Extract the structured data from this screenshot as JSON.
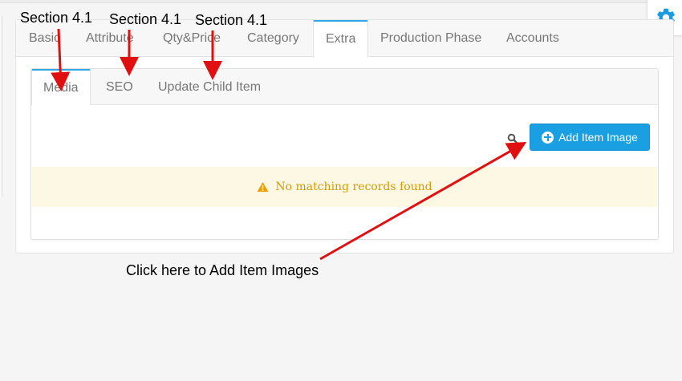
{
  "main_tabs": [
    {
      "label": "Basic"
    },
    {
      "label": "Attribute"
    },
    {
      "label": "Qty&Price"
    },
    {
      "label": "Category"
    },
    {
      "label": "Extra",
      "active": true
    },
    {
      "label": "Production Phase"
    },
    {
      "label": "Accounts"
    }
  ],
  "sub_tabs": [
    {
      "label": "Media",
      "active": true
    },
    {
      "label": "SEO"
    },
    {
      "label": "Update Child Item"
    }
  ],
  "toolbar": {
    "add_item_image_label": "Add Item Image",
    "search_icon": "search-icon"
  },
  "table": {
    "empty_message": "No matching records found",
    "warning_icon": "warning-icon"
  },
  "annotations": {
    "section_labels": [
      "Section 4.1",
      "Section 4.1",
      "Section 4.1"
    ],
    "cta_note": "Click here to Add Item Images"
  },
  "settings": {
    "icon": "gear-icon"
  },
  "colors": {
    "accent": "#1aa0e2",
    "warning_text": "#d49b06",
    "warning_bg": "#fcf8e3",
    "annotation_arrow": "#e01010"
  }
}
